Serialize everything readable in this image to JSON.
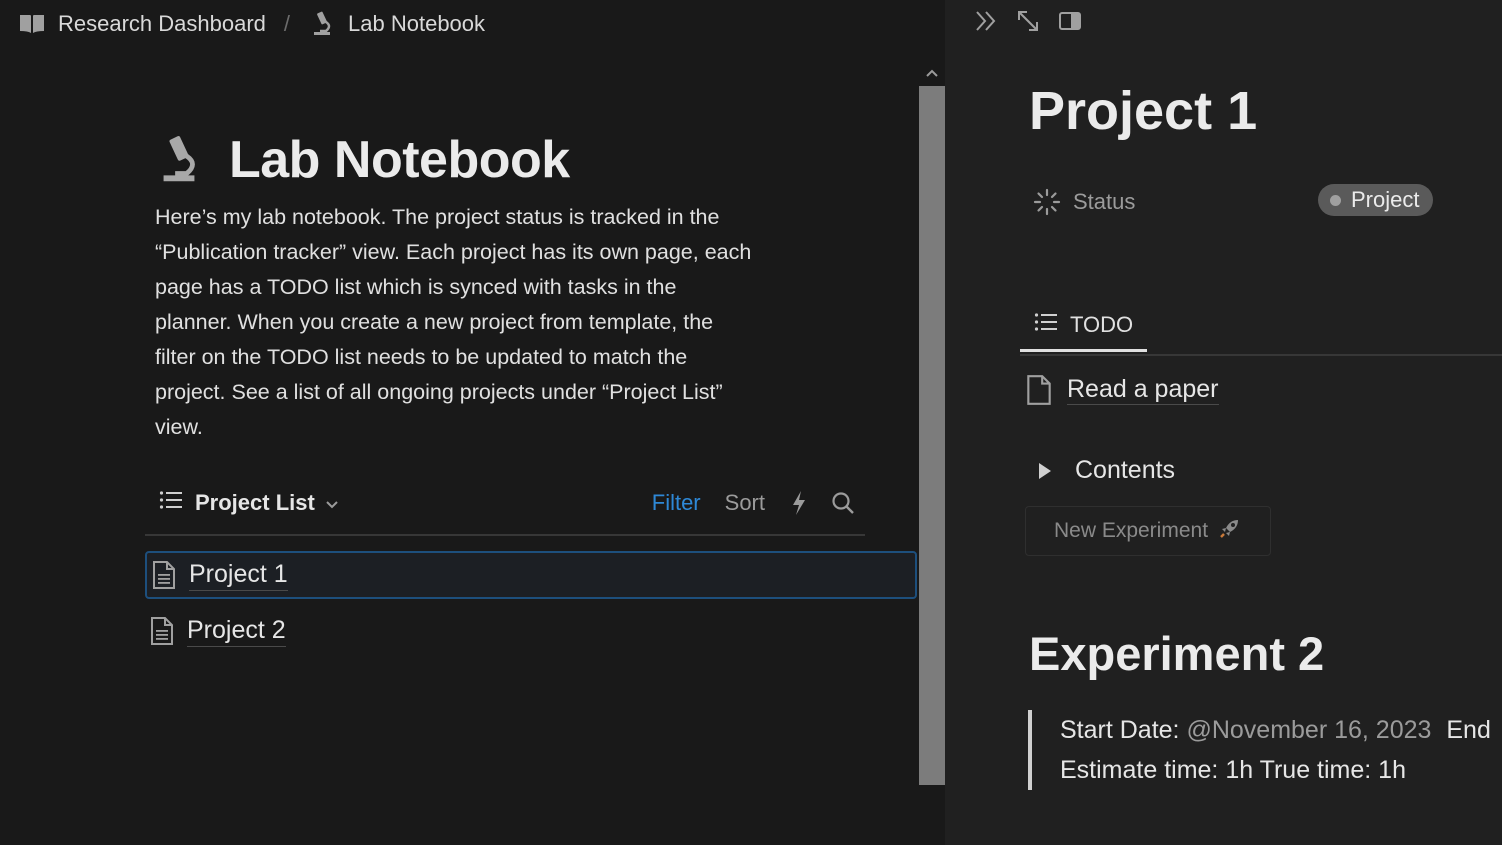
{
  "breadcrumb": {
    "items": [
      {
        "label": "Research Dashboard",
        "icon": "book-icon"
      },
      {
        "label": "Lab Notebook",
        "icon": "microscope-icon"
      }
    ],
    "separator": "/"
  },
  "page": {
    "icon": "microscope-icon",
    "title": "Lab Notebook",
    "description": "Here’s my lab notebook. The project status is tracked in the “Publication tracker” view. Each project has its own page, each page has a TODO list which is synced with tasks in the planner. When you create a new project from template, the filter on the TODO list needs to be updated to match the project. See a list of all ongoing projects under “Project List” view."
  },
  "database": {
    "view_name": "Project List",
    "actions": {
      "filter": "Filter",
      "sort": "Sort"
    },
    "rows": [
      {
        "label": "Project 1",
        "selected": true
      },
      {
        "label": "Project 2",
        "selected": false
      }
    ]
  },
  "peek": {
    "title": "Project 1",
    "property": {
      "name": "Status",
      "value": "Project"
    },
    "todo_tab": "TODO",
    "todo_item": "Read a paper",
    "toggle_label": "Contents",
    "new_button": "New Experiment",
    "experiment_heading": "Experiment 2",
    "quote": {
      "start_label": "Start Date:",
      "start_value": "@November 16, 2023",
      "end_label": "End",
      "estimate": "Estimate time: 1h True time: 1h"
    }
  },
  "colors": {
    "background": "#191919",
    "peek_background": "#202020",
    "accent_blue": "#2e88d6",
    "selection_border": "#1d4f7d"
  }
}
